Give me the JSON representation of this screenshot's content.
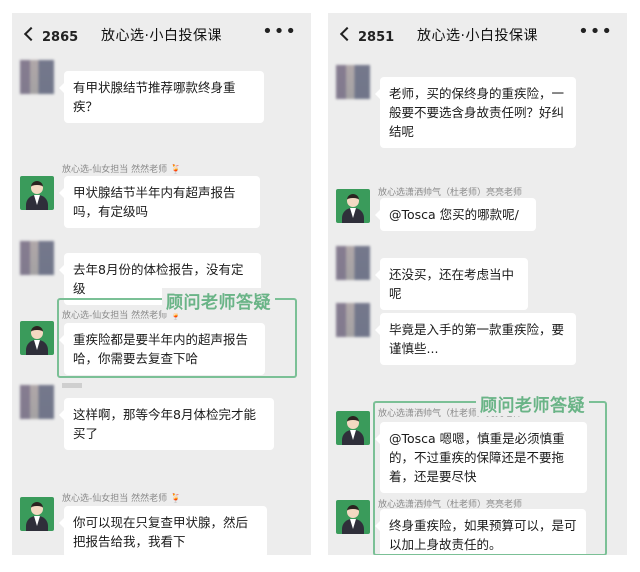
{
  "left": {
    "header": {
      "count": "2865",
      "title": "放心选·小白投保课"
    },
    "messages": [
      {
        "text": "有甲状腺结节推荐哪款终身重疾？"
      },
      {
        "sender": "放心选-仙女担当 然然老师 🍹",
        "text": "甲状腺结节半年内有超声报告吗，有定级吗"
      },
      {
        "text": "去年8月份的体检报告，没有定级"
      },
      {
        "sender": "放心选-仙女担当 然然老师 🍹",
        "text": "重疾险都是要半年内的超声报告哈，你需要去复查下哈"
      },
      {
        "text": "这样啊，那等今年8月体检完才能买了"
      },
      {
        "sender": "放心选-仙女担当 然然老师 🍹",
        "text": "你可以现在只复查甲状腺，然后把报告给我，我看下"
      }
    ],
    "highlight_label": "顾问老师答疑"
  },
  "right": {
    "header": {
      "count": "2851",
      "title": "放心选·小白投保课"
    },
    "messages": [
      {
        "text": "老师，买的保终身的重疾险，一般要不要选含身故责任咧？好纠结呢"
      },
      {
        "sender": "放心选潇洒帅气（杜老师）亮亮老师",
        "text": "@Tosca 您买的哪款呢/"
      },
      {
        "text": "还没买，还在考虑当中呢"
      },
      {
        "text": "毕竟是入手的第一款重疾险，要谨慎些..."
      },
      {
        "sender": "放心选潇洒帅气（杜老师）亮亮老师",
        "text": "@Tosca 嗯嗯，慎重是必须慎重的，不过重疾的保障还是不要拖着，还是要尽快"
      },
      {
        "sender": "放心选潇洒帅气（杜老师）亮亮老师",
        "text": "终身重疾险，如果预算可以，是可以加上身故责任的。"
      }
    ],
    "highlight_label": "顾问老师答疑"
  },
  "icons": {
    "back": "chevron-left-icon",
    "more": "more-dots-icon"
  },
  "colors": {
    "highlight": "#7bc096",
    "chat_bg": "#ededed",
    "avatar_bg": "#3a9b5b"
  }
}
